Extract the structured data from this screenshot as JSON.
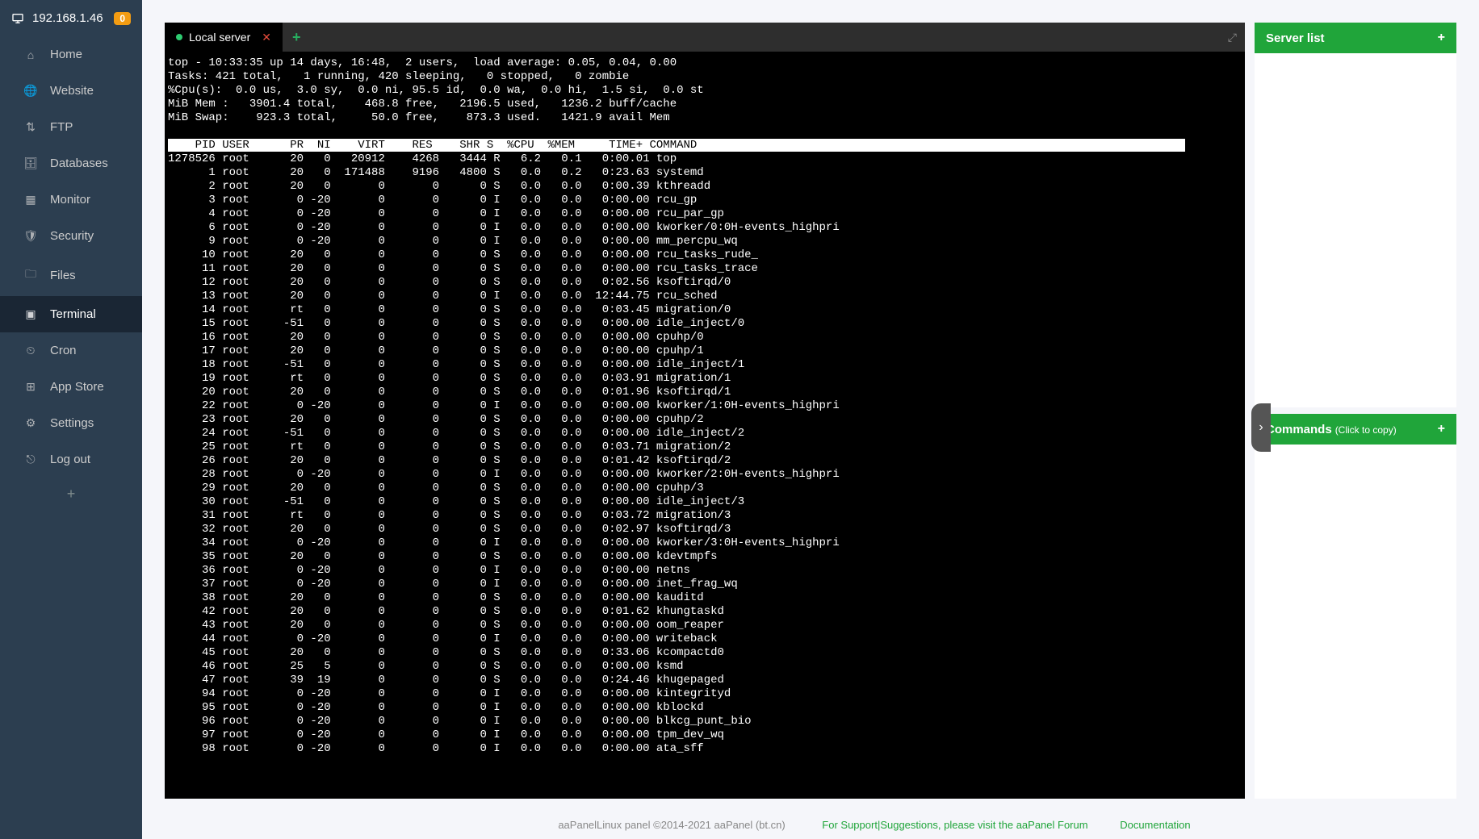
{
  "sidebar": {
    "ip": "192.168.1.46",
    "badge": "0",
    "nav": [
      {
        "label": "Home",
        "icon": "home"
      },
      {
        "label": "Website",
        "icon": "globe"
      },
      {
        "label": "FTP",
        "icon": "ftp"
      },
      {
        "label": "Databases",
        "icon": "database"
      },
      {
        "label": "Monitor",
        "icon": "monitor"
      },
      {
        "label": "Security",
        "icon": "shield"
      },
      {
        "label": "Files",
        "icon": "folder"
      },
      {
        "label": "Terminal",
        "icon": "terminal",
        "active": true
      },
      {
        "label": "Cron",
        "icon": "clock"
      },
      {
        "label": "App Store",
        "icon": "grid"
      },
      {
        "label": "Settings",
        "icon": "gear"
      },
      {
        "label": "Log out",
        "icon": "logout"
      }
    ]
  },
  "tabs": {
    "active_label": "Local server"
  },
  "right": {
    "server_list": "Server list",
    "commands": "Commands",
    "commands_sub": "(Click to copy)"
  },
  "footer": {
    "copyright": "aaPanelLinux panel ©2014-2021 aaPanel (bt.cn)",
    "support": "For Support|Suggestions, please visit the aaPanel Forum",
    "docs": "Documentation"
  },
  "terminal": {
    "summary": [
      "top - 10:33:35 up 14 days, 16:48,  2 users,  load average: 0.05, 0.04, 0.00",
      "Tasks: 421 total,   1 running, 420 sleeping,   0 stopped,   0 zombie",
      "%Cpu(s):  0.0 us,  3.0 sy,  0.0 ni, 95.5 id,  0.0 wa,  0.0 hi,  1.5 si,  0.0 st",
      "MiB Mem :   3901.4 total,    468.8 free,   2196.5 used,   1236.2 buff/cache",
      "MiB Swap:    923.3 total,     50.0 free,    873.3 used.   1421.9 avail Mem"
    ],
    "header": "    PID USER      PR  NI    VIRT    RES    SHR S  %CPU  %MEM     TIME+ COMMAND",
    "rows": [
      {
        "pid": "1278526",
        "user": "root",
        "pr": "20",
        "ni": "0",
        "virt": "20912",
        "res": "4268",
        "shr": "3444",
        "s": "R",
        "cpu": "6.2",
        "mem": "0.1",
        "time": "0:00.01",
        "cmd": "top"
      },
      {
        "pid": "1",
        "user": "root",
        "pr": "20",
        "ni": "0",
        "virt": "171488",
        "res": "9196",
        "shr": "4800",
        "s": "S",
        "cpu": "0.0",
        "mem": "0.2",
        "time": "0:23.63",
        "cmd": "systemd"
      },
      {
        "pid": "2",
        "user": "root",
        "pr": "20",
        "ni": "0",
        "virt": "0",
        "res": "0",
        "shr": "0",
        "s": "S",
        "cpu": "0.0",
        "mem": "0.0",
        "time": "0:00.39",
        "cmd": "kthreadd"
      },
      {
        "pid": "3",
        "user": "root",
        "pr": "0",
        "ni": "-20",
        "virt": "0",
        "res": "0",
        "shr": "0",
        "s": "I",
        "cpu": "0.0",
        "mem": "0.0",
        "time": "0:00.00",
        "cmd": "rcu_gp"
      },
      {
        "pid": "4",
        "user": "root",
        "pr": "0",
        "ni": "-20",
        "virt": "0",
        "res": "0",
        "shr": "0",
        "s": "I",
        "cpu": "0.0",
        "mem": "0.0",
        "time": "0:00.00",
        "cmd": "rcu_par_gp"
      },
      {
        "pid": "6",
        "user": "root",
        "pr": "0",
        "ni": "-20",
        "virt": "0",
        "res": "0",
        "shr": "0",
        "s": "I",
        "cpu": "0.0",
        "mem": "0.0",
        "time": "0:00.00",
        "cmd": "kworker/0:0H-events_highpri"
      },
      {
        "pid": "9",
        "user": "root",
        "pr": "0",
        "ni": "-20",
        "virt": "0",
        "res": "0",
        "shr": "0",
        "s": "I",
        "cpu": "0.0",
        "mem": "0.0",
        "time": "0:00.00",
        "cmd": "mm_percpu_wq"
      },
      {
        "pid": "10",
        "user": "root",
        "pr": "20",
        "ni": "0",
        "virt": "0",
        "res": "0",
        "shr": "0",
        "s": "S",
        "cpu": "0.0",
        "mem": "0.0",
        "time": "0:00.00",
        "cmd": "rcu_tasks_rude_"
      },
      {
        "pid": "11",
        "user": "root",
        "pr": "20",
        "ni": "0",
        "virt": "0",
        "res": "0",
        "shr": "0",
        "s": "S",
        "cpu": "0.0",
        "mem": "0.0",
        "time": "0:00.00",
        "cmd": "rcu_tasks_trace"
      },
      {
        "pid": "12",
        "user": "root",
        "pr": "20",
        "ni": "0",
        "virt": "0",
        "res": "0",
        "shr": "0",
        "s": "S",
        "cpu": "0.0",
        "mem": "0.0",
        "time": "0:02.56",
        "cmd": "ksoftirqd/0"
      },
      {
        "pid": "13",
        "user": "root",
        "pr": "20",
        "ni": "0",
        "virt": "0",
        "res": "0",
        "shr": "0",
        "s": "I",
        "cpu": "0.0",
        "mem": "0.0",
        "time": "12:44.75",
        "cmd": "rcu_sched"
      },
      {
        "pid": "14",
        "user": "root",
        "pr": "rt",
        "ni": "0",
        "virt": "0",
        "res": "0",
        "shr": "0",
        "s": "S",
        "cpu": "0.0",
        "mem": "0.0",
        "time": "0:03.45",
        "cmd": "migration/0"
      },
      {
        "pid": "15",
        "user": "root",
        "pr": "-51",
        "ni": "0",
        "virt": "0",
        "res": "0",
        "shr": "0",
        "s": "S",
        "cpu": "0.0",
        "mem": "0.0",
        "time": "0:00.00",
        "cmd": "idle_inject/0"
      },
      {
        "pid": "16",
        "user": "root",
        "pr": "20",
        "ni": "0",
        "virt": "0",
        "res": "0",
        "shr": "0",
        "s": "S",
        "cpu": "0.0",
        "mem": "0.0",
        "time": "0:00.00",
        "cmd": "cpuhp/0"
      },
      {
        "pid": "17",
        "user": "root",
        "pr": "20",
        "ni": "0",
        "virt": "0",
        "res": "0",
        "shr": "0",
        "s": "S",
        "cpu": "0.0",
        "mem": "0.0",
        "time": "0:00.00",
        "cmd": "cpuhp/1"
      },
      {
        "pid": "18",
        "user": "root",
        "pr": "-51",
        "ni": "0",
        "virt": "0",
        "res": "0",
        "shr": "0",
        "s": "S",
        "cpu": "0.0",
        "mem": "0.0",
        "time": "0:00.00",
        "cmd": "idle_inject/1"
      },
      {
        "pid": "19",
        "user": "root",
        "pr": "rt",
        "ni": "0",
        "virt": "0",
        "res": "0",
        "shr": "0",
        "s": "S",
        "cpu": "0.0",
        "mem": "0.0",
        "time": "0:03.91",
        "cmd": "migration/1"
      },
      {
        "pid": "20",
        "user": "root",
        "pr": "20",
        "ni": "0",
        "virt": "0",
        "res": "0",
        "shr": "0",
        "s": "S",
        "cpu": "0.0",
        "mem": "0.0",
        "time": "0:01.96",
        "cmd": "ksoftirqd/1"
      },
      {
        "pid": "22",
        "user": "root",
        "pr": "0",
        "ni": "-20",
        "virt": "0",
        "res": "0",
        "shr": "0",
        "s": "I",
        "cpu": "0.0",
        "mem": "0.0",
        "time": "0:00.00",
        "cmd": "kworker/1:0H-events_highpri"
      },
      {
        "pid": "23",
        "user": "root",
        "pr": "20",
        "ni": "0",
        "virt": "0",
        "res": "0",
        "shr": "0",
        "s": "S",
        "cpu": "0.0",
        "mem": "0.0",
        "time": "0:00.00",
        "cmd": "cpuhp/2"
      },
      {
        "pid": "24",
        "user": "root",
        "pr": "-51",
        "ni": "0",
        "virt": "0",
        "res": "0",
        "shr": "0",
        "s": "S",
        "cpu": "0.0",
        "mem": "0.0",
        "time": "0:00.00",
        "cmd": "idle_inject/2"
      },
      {
        "pid": "25",
        "user": "root",
        "pr": "rt",
        "ni": "0",
        "virt": "0",
        "res": "0",
        "shr": "0",
        "s": "S",
        "cpu": "0.0",
        "mem": "0.0",
        "time": "0:03.71",
        "cmd": "migration/2"
      },
      {
        "pid": "26",
        "user": "root",
        "pr": "20",
        "ni": "0",
        "virt": "0",
        "res": "0",
        "shr": "0",
        "s": "S",
        "cpu": "0.0",
        "mem": "0.0",
        "time": "0:01.42",
        "cmd": "ksoftirqd/2"
      },
      {
        "pid": "28",
        "user": "root",
        "pr": "0",
        "ni": "-20",
        "virt": "0",
        "res": "0",
        "shr": "0",
        "s": "I",
        "cpu": "0.0",
        "mem": "0.0",
        "time": "0:00.00",
        "cmd": "kworker/2:0H-events_highpri"
      },
      {
        "pid": "29",
        "user": "root",
        "pr": "20",
        "ni": "0",
        "virt": "0",
        "res": "0",
        "shr": "0",
        "s": "S",
        "cpu": "0.0",
        "mem": "0.0",
        "time": "0:00.00",
        "cmd": "cpuhp/3"
      },
      {
        "pid": "30",
        "user": "root",
        "pr": "-51",
        "ni": "0",
        "virt": "0",
        "res": "0",
        "shr": "0",
        "s": "S",
        "cpu": "0.0",
        "mem": "0.0",
        "time": "0:00.00",
        "cmd": "idle_inject/3"
      },
      {
        "pid": "31",
        "user": "root",
        "pr": "rt",
        "ni": "0",
        "virt": "0",
        "res": "0",
        "shr": "0",
        "s": "S",
        "cpu": "0.0",
        "mem": "0.0",
        "time": "0:03.72",
        "cmd": "migration/3"
      },
      {
        "pid": "32",
        "user": "root",
        "pr": "20",
        "ni": "0",
        "virt": "0",
        "res": "0",
        "shr": "0",
        "s": "S",
        "cpu": "0.0",
        "mem": "0.0",
        "time": "0:02.97",
        "cmd": "ksoftirqd/3"
      },
      {
        "pid": "34",
        "user": "root",
        "pr": "0",
        "ni": "-20",
        "virt": "0",
        "res": "0",
        "shr": "0",
        "s": "I",
        "cpu": "0.0",
        "mem": "0.0",
        "time": "0:00.00",
        "cmd": "kworker/3:0H-events_highpri"
      },
      {
        "pid": "35",
        "user": "root",
        "pr": "20",
        "ni": "0",
        "virt": "0",
        "res": "0",
        "shr": "0",
        "s": "S",
        "cpu": "0.0",
        "mem": "0.0",
        "time": "0:00.00",
        "cmd": "kdevtmpfs"
      },
      {
        "pid": "36",
        "user": "root",
        "pr": "0",
        "ni": "-20",
        "virt": "0",
        "res": "0",
        "shr": "0",
        "s": "I",
        "cpu": "0.0",
        "mem": "0.0",
        "time": "0:00.00",
        "cmd": "netns"
      },
      {
        "pid": "37",
        "user": "root",
        "pr": "0",
        "ni": "-20",
        "virt": "0",
        "res": "0",
        "shr": "0",
        "s": "I",
        "cpu": "0.0",
        "mem": "0.0",
        "time": "0:00.00",
        "cmd": "inet_frag_wq"
      },
      {
        "pid": "38",
        "user": "root",
        "pr": "20",
        "ni": "0",
        "virt": "0",
        "res": "0",
        "shr": "0",
        "s": "S",
        "cpu": "0.0",
        "mem": "0.0",
        "time": "0:00.00",
        "cmd": "kauditd"
      },
      {
        "pid": "42",
        "user": "root",
        "pr": "20",
        "ni": "0",
        "virt": "0",
        "res": "0",
        "shr": "0",
        "s": "S",
        "cpu": "0.0",
        "mem": "0.0",
        "time": "0:01.62",
        "cmd": "khungtaskd"
      },
      {
        "pid": "43",
        "user": "root",
        "pr": "20",
        "ni": "0",
        "virt": "0",
        "res": "0",
        "shr": "0",
        "s": "S",
        "cpu": "0.0",
        "mem": "0.0",
        "time": "0:00.00",
        "cmd": "oom_reaper"
      },
      {
        "pid": "44",
        "user": "root",
        "pr": "0",
        "ni": "-20",
        "virt": "0",
        "res": "0",
        "shr": "0",
        "s": "I",
        "cpu": "0.0",
        "mem": "0.0",
        "time": "0:00.00",
        "cmd": "writeback"
      },
      {
        "pid": "45",
        "user": "root",
        "pr": "20",
        "ni": "0",
        "virt": "0",
        "res": "0",
        "shr": "0",
        "s": "S",
        "cpu": "0.0",
        "mem": "0.0",
        "time": "0:33.06",
        "cmd": "kcompactd0"
      },
      {
        "pid": "46",
        "user": "root",
        "pr": "25",
        "ni": "5",
        "virt": "0",
        "res": "0",
        "shr": "0",
        "s": "S",
        "cpu": "0.0",
        "mem": "0.0",
        "time": "0:00.00",
        "cmd": "ksmd"
      },
      {
        "pid": "47",
        "user": "root",
        "pr": "39",
        "ni": "19",
        "virt": "0",
        "res": "0",
        "shr": "0",
        "s": "S",
        "cpu": "0.0",
        "mem": "0.0",
        "time": "0:24.46",
        "cmd": "khugepaged"
      },
      {
        "pid": "94",
        "user": "root",
        "pr": "0",
        "ni": "-20",
        "virt": "0",
        "res": "0",
        "shr": "0",
        "s": "I",
        "cpu": "0.0",
        "mem": "0.0",
        "time": "0:00.00",
        "cmd": "kintegrityd"
      },
      {
        "pid": "95",
        "user": "root",
        "pr": "0",
        "ni": "-20",
        "virt": "0",
        "res": "0",
        "shr": "0",
        "s": "I",
        "cpu": "0.0",
        "mem": "0.0",
        "time": "0:00.00",
        "cmd": "kblockd"
      },
      {
        "pid": "96",
        "user": "root",
        "pr": "0",
        "ni": "-20",
        "virt": "0",
        "res": "0",
        "shr": "0",
        "s": "I",
        "cpu": "0.0",
        "mem": "0.0",
        "time": "0:00.00",
        "cmd": "blkcg_punt_bio"
      },
      {
        "pid": "97",
        "user": "root",
        "pr": "0",
        "ni": "-20",
        "virt": "0",
        "res": "0",
        "shr": "0",
        "s": "I",
        "cpu": "0.0",
        "mem": "0.0",
        "time": "0:00.00",
        "cmd": "tpm_dev_wq"
      },
      {
        "pid": "98",
        "user": "root",
        "pr": "0",
        "ni": "-20",
        "virt": "0",
        "res": "0",
        "shr": "0",
        "s": "I",
        "cpu": "0.0",
        "mem": "0.0",
        "time": "0:00.00",
        "cmd": "ata_sff"
      }
    ]
  }
}
